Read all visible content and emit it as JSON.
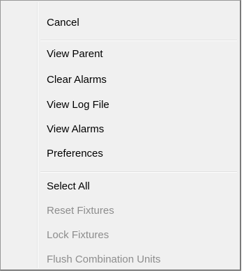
{
  "context_menu": {
    "groups": [
      {
        "items": [
          {
            "label": "Cancel",
            "enabled": true
          }
        ]
      },
      {
        "items": [
          {
            "label": "View Parent",
            "enabled": true
          },
          {
            "label": "Clear Alarms",
            "enabled": true
          },
          {
            "label": "View Log File",
            "enabled": true
          },
          {
            "label": "View Alarms",
            "enabled": true
          },
          {
            "label": "Preferences",
            "enabled": true
          }
        ]
      },
      {
        "items": [
          {
            "label": "Select All",
            "enabled": true
          },
          {
            "label": "Reset Fixtures",
            "enabled": false
          },
          {
            "label": "Lock Fixtures",
            "enabled": false
          },
          {
            "label": "Flush Combination Units",
            "enabled": false
          }
        ]
      }
    ]
  }
}
